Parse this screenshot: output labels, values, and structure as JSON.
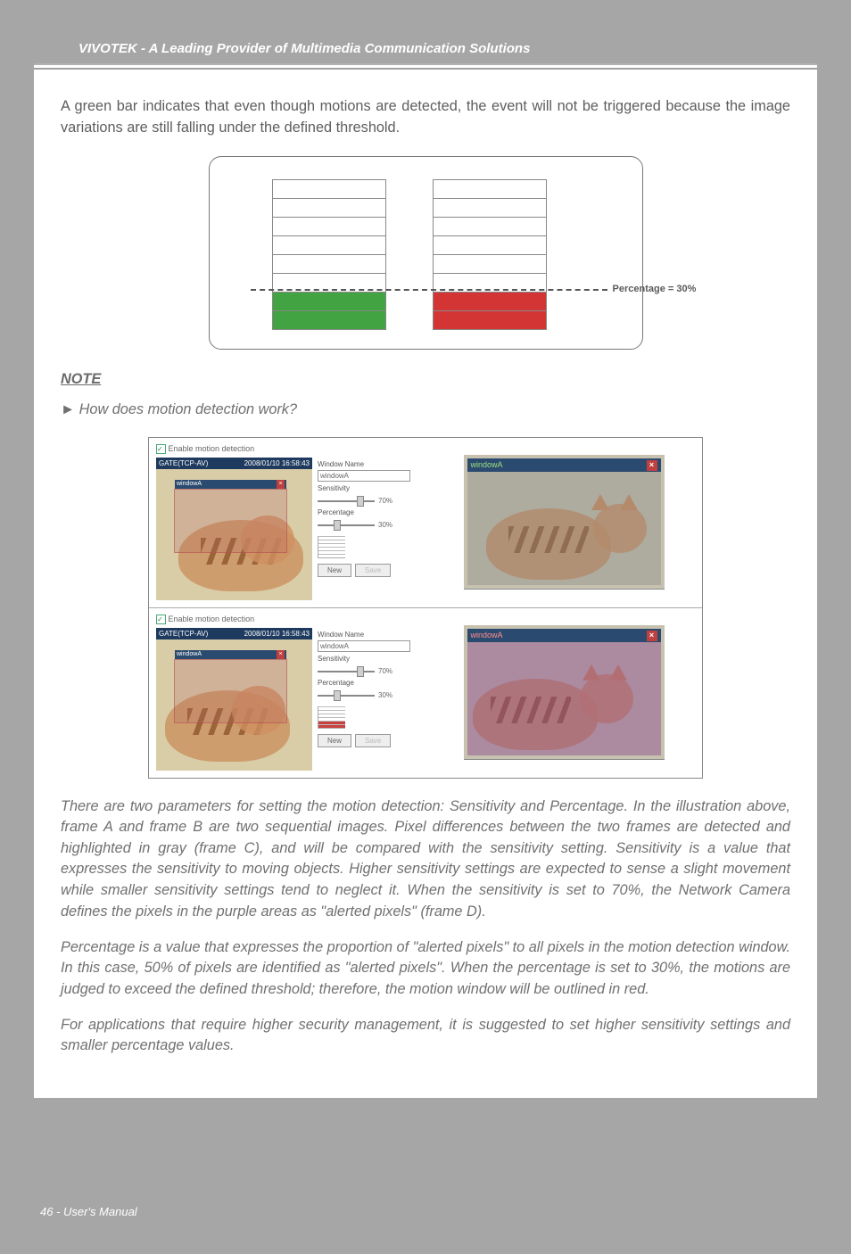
{
  "header": {
    "title": "VIVOTEK - A Leading Provider of Multimedia Communication Solutions"
  },
  "body": {
    "intro": "A green bar indicates that even though motions are detected, the event will not be triggered because the image variations are still falling under the defined threshold.",
    "pct_label": "Percentage = 30%",
    "note_heading": "NOTE",
    "note_question_marker": "►",
    "note_question": "How does motion detection work?",
    "para1": "There are two parameters for setting the motion detection: Sensitivity and Percentage. In the illustration above, frame A and frame B are two sequential images. Pixel differences between the two frames are detected and highlighted in gray (frame C), and will be compared with the sensitivity setting. Sensitivity is a value that expresses the sensitivity to moving objects. Higher sensitivity settings are expected to sense a slight movement while smaller sensitivity settings tend to neglect it. When the sensitivity is set to 70%, the Network Camera defines the pixels in the purple areas as \"alerted pixels\" (frame D).",
    "para2": "Percentage is a value that expresses the proportion of \"alerted pixels\" to all pixels in the motion detection window. In this case, 50% of pixels are identified as \"alerted pixels\". When the percentage is set to 30%, the motions are judged to exceed the defined threshold; therefore, the motion window will be outlined in red.",
    "para3": "For applications that require higher security management, it is suggested to set higher sensitivity settings and smaller percentage values."
  },
  "panel": {
    "enable_label": "Enable motion detection",
    "video_left_title": "GATE(TCP-AV)",
    "video_right_title": "2008/01/10 16:58:43",
    "region_name": "windowA",
    "controls": {
      "window_name_label": "Window Name",
      "window_name_value": "windowA",
      "sensitivity_label": "Sensitivity",
      "sensitivity_value": "70%",
      "percentage_label": "Percentage",
      "percentage_value": "30%",
      "btn_new": "New",
      "btn_save": "Save"
    },
    "zoom_title": "windowA"
  },
  "footer": {
    "text": "46 - User's Manual"
  },
  "chart_data": {
    "type": "bar",
    "title": "Motion indicator bars at Percentage threshold = 30%",
    "threshold_percent": 30,
    "series": [
      {
        "name": "green (below threshold event)",
        "value_percent": 30,
        "color": "#41a341"
      },
      {
        "name": "red (above threshold event)",
        "value_percent": 30,
        "color": "#d33535"
      }
    ],
    "grid_rows_total": 8,
    "ylim_percent": [
      0,
      100
    ]
  }
}
